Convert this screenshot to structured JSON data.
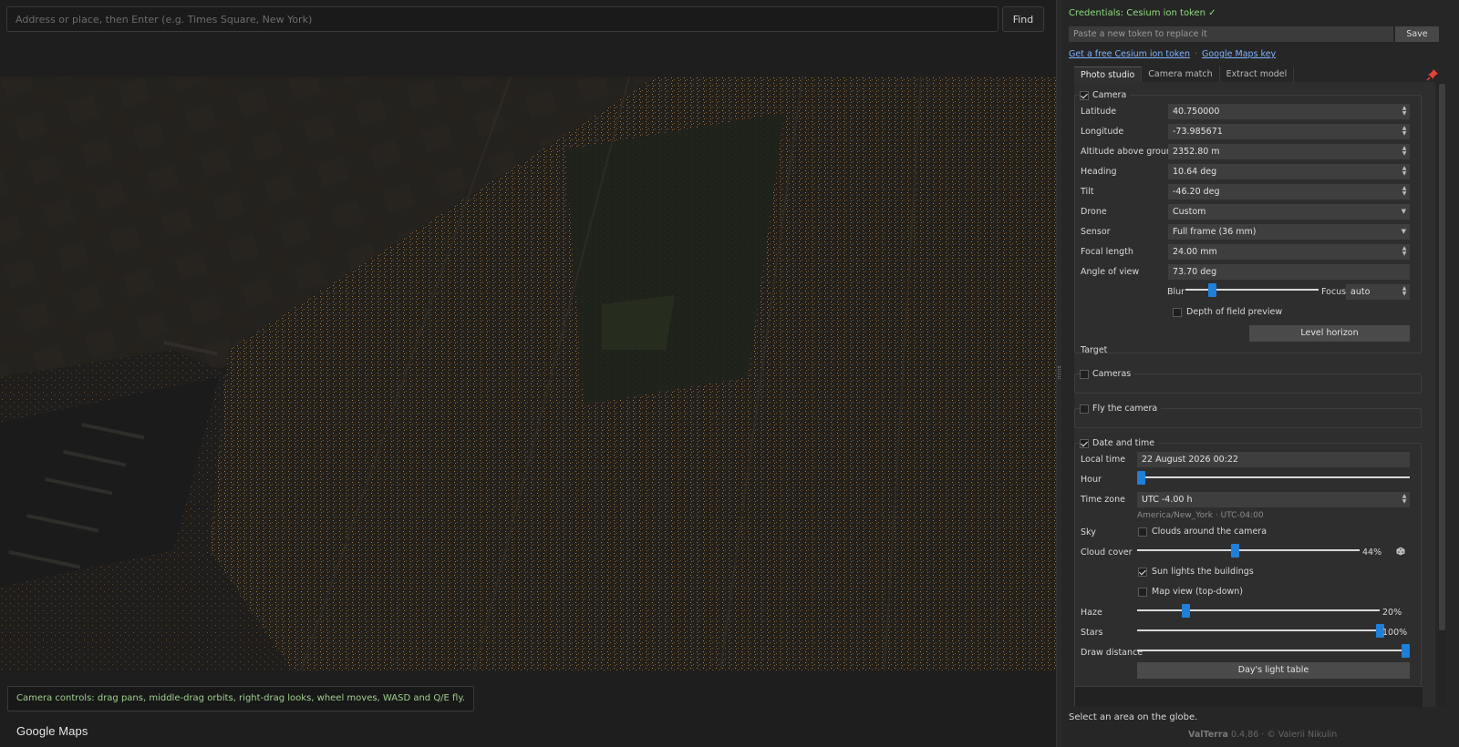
{
  "search": {
    "placeholder": "Address or place, then Enter (e.g. Times Square, New York)",
    "find_label": "Find"
  },
  "viewer": {
    "controls_hint": "Camera controls: drag pans, middle-drag orbits, right-drag looks, wheel moves, WASD and Q/E fly.",
    "attribution": "Google Maps"
  },
  "credentials": {
    "title": "Credentials: Cesium ion token ✓",
    "token_placeholder": "Paste a new token to replace it",
    "save_label": "Save",
    "link_cesium": "Get a free Cesium ion token",
    "link_separator": "·",
    "link_google": "Google Maps key"
  },
  "tabs": [
    {
      "label": "Photo studio",
      "active": true
    },
    {
      "label": "Camera match",
      "active": false
    },
    {
      "label": "Extract model",
      "active": false
    }
  ],
  "camera": {
    "title": "Camera",
    "checked": true,
    "latitude_label": "Latitude",
    "latitude": "40.750000",
    "longitude_label": "Longitude",
    "longitude": "-73.985671",
    "altitude_label": "Altitude above ground",
    "altitude": "2352.80 m",
    "heading_label": "Heading",
    "heading": "10.64 deg",
    "tilt_label": "Tilt",
    "tilt": "-46.20 deg",
    "drone_label": "Drone",
    "drone": "Custom",
    "sensor_label": "Sensor",
    "sensor": "Full frame (36 mm)",
    "focal_label": "Focal length",
    "focal": "24.00 mm",
    "aov_label": "Angle of view",
    "aov": "73.70 deg",
    "blur_label": "Blur",
    "blur_level": 0.2,
    "focus_label": "Focus",
    "focus": "auto",
    "dof_label": "Depth of field preview",
    "dof_checked": false,
    "level_label": "Level horizon",
    "target_label": "Target"
  },
  "cameras": {
    "title": "Cameras",
    "checked": false
  },
  "fly": {
    "title": "Fly the camera",
    "checked": false
  },
  "datetime": {
    "title": "Date and time",
    "checked": true,
    "local_time_label": "Local time",
    "local_time": "22 August 2026  00:22",
    "hour_label": "Hour",
    "hour_level": 0.015,
    "tz_label": "Time zone",
    "tz": "UTC -4.00 h",
    "tz_info": "America/New_York  ·  UTC-04:00",
    "sky_label": "Sky",
    "clouds_label": "Clouds around the camera",
    "clouds_checked": false,
    "cloud_cover_label": "Cloud cover",
    "cloud_cover": "44%",
    "cloud_level": 0.44,
    "sun_label": "Sun lights the buildings",
    "sun_checked": true,
    "mapview_label": "Map view (top-down)",
    "mapview_checked": false,
    "haze_label": "Haze",
    "haze": "20%",
    "haze_level": 0.2,
    "stars_label": "Stars",
    "stars": "100%",
    "stars_level": 1.0,
    "draw_label": "Draw distance",
    "draw_level": 1.0,
    "light_table_label": "Day's light table"
  },
  "footer": {
    "status": "Select an area on the globe.",
    "app_name": "ValTerra",
    "version": " 0.4.86 · © Valerii Nikulin"
  },
  "colors": {
    "accent": "#1f7fd9",
    "success": "#8ddc7d",
    "link": "#7fb3ff"
  }
}
